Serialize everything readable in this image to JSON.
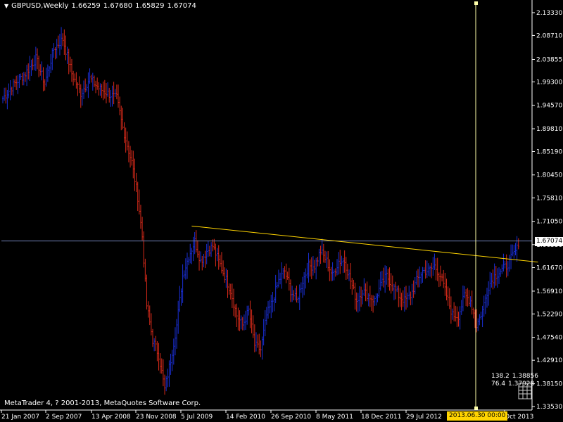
{
  "window": {
    "symbol_label": "GBPUSD,Weekly",
    "ohlc": [
      "1.66259",
      "1.67680",
      "1.65829",
      "1.67074"
    ],
    "copyright": "MetaTrader 4, ? 2001-2013, MetaQuotes Software Corp.",
    "current_price_label": "1.67074",
    "cursor_date_label": "2013.06.30 00:00",
    "indicator_values": [
      [
        "138.2",
        "1.38856"
      ],
      [
        "76.4",
        "1.37928"
      ]
    ]
  },
  "colors": {
    "background": "#000000",
    "bull_bar": "#1a2fd6",
    "bear_bar": "#d62a1a",
    "trendline": "#ffd400",
    "crosshair": "#ffffaa",
    "price_line": "#6e7fb4",
    "axis": "#ffffff"
  },
  "chart_data": {
    "type": "bar",
    "title": "GBPUSD,Weekly",
    "y_ticks": [
      "2.13330",
      "2.08710",
      "2.03855",
      "1.99300",
      "1.94570",
      "1.89810",
      "1.85190",
      "1.80450",
      "1.75810",
      "1.71050",
      "1.66330",
      "1.61670",
      "1.56910",
      "1.52290",
      "1.47540",
      "1.42910",
      "1.38150",
      "1.33530"
    ],
    "x_ticks": [
      "21 Jan 2007",
      "2 Sep 2007",
      "13 Apr 2008",
      "23 Nov 2008",
      "5 Jul 2009",
      "14 Feb 2010",
      "26 Sep 2010",
      "8 May 2011",
      "18 Dec 2011",
      "29 Jul 2012",
      "Oct 2013"
    ],
    "ylim": [
      1.3353,
      2.1333
    ],
    "current_price": 1.67074,
    "anchors": [
      [
        0,
        1.96
      ],
      [
        8,
        1.99
      ],
      [
        15,
        2.01
      ],
      [
        22,
        2.04
      ],
      [
        28,
        1.99
      ],
      [
        34,
        2.06
      ],
      [
        40,
        2.08
      ],
      [
        46,
        2.01
      ],
      [
        52,
        1.97
      ],
      [
        58,
        2.0
      ],
      [
        64,
        1.98
      ],
      [
        70,
        1.97
      ],
      [
        76,
        1.96
      ],
      [
        80,
        1.9
      ],
      [
        86,
        1.83
      ],
      [
        90,
        1.76
      ],
      [
        93,
        1.68
      ],
      [
        96,
        1.54
      ],
      [
        100,
        1.47
      ],
      [
        104,
        1.44
      ],
      [
        108,
        1.37
      ],
      [
        112,
        1.43
      ],
      [
        116,
        1.5
      ],
      [
        120,
        1.6
      ],
      [
        124,
        1.64
      ],
      [
        128,
        1.67
      ],
      [
        132,
        1.63
      ],
      [
        136,
        1.65
      ],
      [
        140,
        1.66
      ],
      [
        144,
        1.63
      ],
      [
        148,
        1.6
      ],
      [
        152,
        1.57
      ],
      [
        156,
        1.52
      ],
      [
        160,
        1.5
      ],
      [
        164,
        1.53
      ],
      [
        168,
        1.46
      ],
      [
        172,
        1.45
      ],
      [
        176,
        1.52
      ],
      [
        180,
        1.55
      ],
      [
        184,
        1.59
      ],
      [
        188,
        1.61
      ],
      [
        192,
        1.57
      ],
      [
        196,
        1.55
      ],
      [
        200,
        1.59
      ],
      [
        204,
        1.62
      ],
      [
        208,
        1.62
      ],
      [
        212,
        1.65
      ],
      [
        216,
        1.63
      ],
      [
        220,
        1.6
      ],
      [
        224,
        1.63
      ],
      [
        228,
        1.63
      ],
      [
        232,
        1.59
      ],
      [
        236,
        1.55
      ],
      [
        240,
        1.57
      ],
      [
        244,
        1.56
      ],
      [
        248,
        1.55
      ],
      [
        252,
        1.58
      ],
      [
        256,
        1.6
      ],
      [
        260,
        1.58
      ],
      [
        264,
        1.56
      ],
      [
        268,
        1.55
      ],
      [
        272,
        1.56
      ],
      [
        276,
        1.59
      ],
      [
        280,
        1.61
      ],
      [
        284,
        1.61
      ],
      [
        288,
        1.62
      ],
      [
        292,
        1.6
      ],
      [
        296,
        1.56
      ],
      [
        300,
        1.52
      ],
      [
        304,
        1.52
      ],
      [
        308,
        1.56
      ],
      [
        312,
        1.55
      ],
      [
        316,
        1.5
      ],
      [
        320,
        1.53
      ],
      [
        324,
        1.58
      ],
      [
        328,
        1.6
      ],
      [
        332,
        1.61
      ],
      [
        336,
        1.62
      ],
      [
        340,
        1.64
      ],
      [
        344,
        1.66
      ]
    ],
    "trendline": [
      [
        126,
        1.701
      ],
      [
        357,
        1.628
      ]
    ]
  }
}
